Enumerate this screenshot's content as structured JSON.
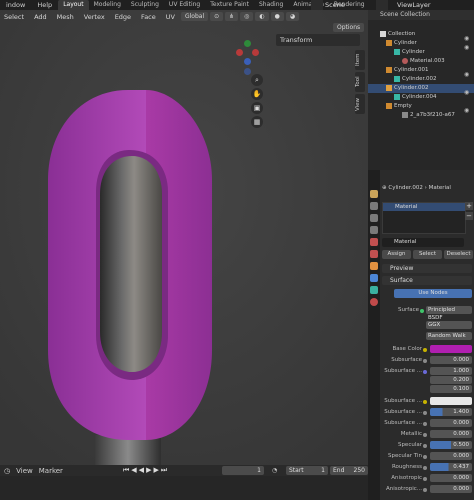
{
  "topbar": {
    "menus": [
      "indow",
      "Help"
    ],
    "workspaces": [
      "Layout",
      "Modeling",
      "Sculpting",
      "UV Editing",
      "Texture Paint",
      "Shading",
      "Animation",
      "Rendering"
    ],
    "active_workspace": "Layout",
    "scene_label": "Scene",
    "viewlayer_label": "ViewLayer"
  },
  "viewport": {
    "header": {
      "select": "Select",
      "add": "Add",
      "mesh": "Mesh",
      "vertex": "Vertex",
      "edge": "Edge",
      "face": "Face",
      "uv": "UV",
      "orientation": "Global",
      "options": "Options"
    },
    "transform_label": "Transform",
    "side_tabs": [
      "Item",
      "Tool",
      "View"
    ],
    "gizmo": {
      "y": "Y",
      "x": "X",
      "z": "Z"
    }
  },
  "timeline": {
    "menus": [
      "View",
      "Marker"
    ],
    "frame_current": "1",
    "start_label": "Start",
    "start_value": "1",
    "end_label": "End",
    "end_value": "250"
  },
  "outliner": {
    "header": "Scene Collection",
    "items": [
      {
        "label": "Collection"
      },
      {
        "label": "Cylinder"
      },
      {
        "label": "Cylinder"
      },
      {
        "label": "Material.003"
      },
      {
        "label": "Cylinder.001"
      },
      {
        "label": "Cylinder.002"
      },
      {
        "label": "Cylinder.002"
      },
      {
        "label": "Cylinder.004"
      },
      {
        "label": "Empty"
      },
      {
        "label": "2_a7b3f210-a67"
      }
    ]
  },
  "properties": {
    "breadcrumb_object": "Cylinder.002",
    "breadcrumb_material": "Material",
    "slot_name": "Material",
    "material_name": "Material",
    "assign": "Assign",
    "select": "Select",
    "deselect": "Deselect",
    "preview": "Preview",
    "surface_section": "Surface",
    "use_nodes": "Use Nodes",
    "surface_label": "Surface",
    "surface_value": "Principled BSDF",
    "distribution": "GGX",
    "subsurface_method": "Random Walk",
    "base_color_label": "Base Color",
    "base_color": "#b01fb0",
    "subsurface_label": "Subsurface",
    "subsurface_value": "0.000",
    "subsurface_radius_label": "Subsurface ...",
    "subsurface_radius": [
      "1.000",
      "0.200",
      "0.100"
    ],
    "subsurface_color_label": "Subsurface ...",
    "subsurface_ior_label": "Subsurface ...",
    "subsurface_ior": "1.400",
    "subsurface_aniso_label": "Subsurface ...",
    "subsurface_aniso": "0.000",
    "metallic_label": "Metallic",
    "metallic": "0.000",
    "specular_label": "Specular",
    "specular": "0.500",
    "specular_tint_label": "Specular Tin",
    "specular_tint": "0.000",
    "roughness_label": "Roughness",
    "roughness": "0.437",
    "anisotropic_label": "Anisotropic",
    "anisotropic": "0.000",
    "anisotropic_rot_label": "Anisotropic...",
    "anisotropic_rot": "0.000"
  },
  "colors": {
    "accent": "#4772b3",
    "object_magenta": "#a13aa8"
  }
}
